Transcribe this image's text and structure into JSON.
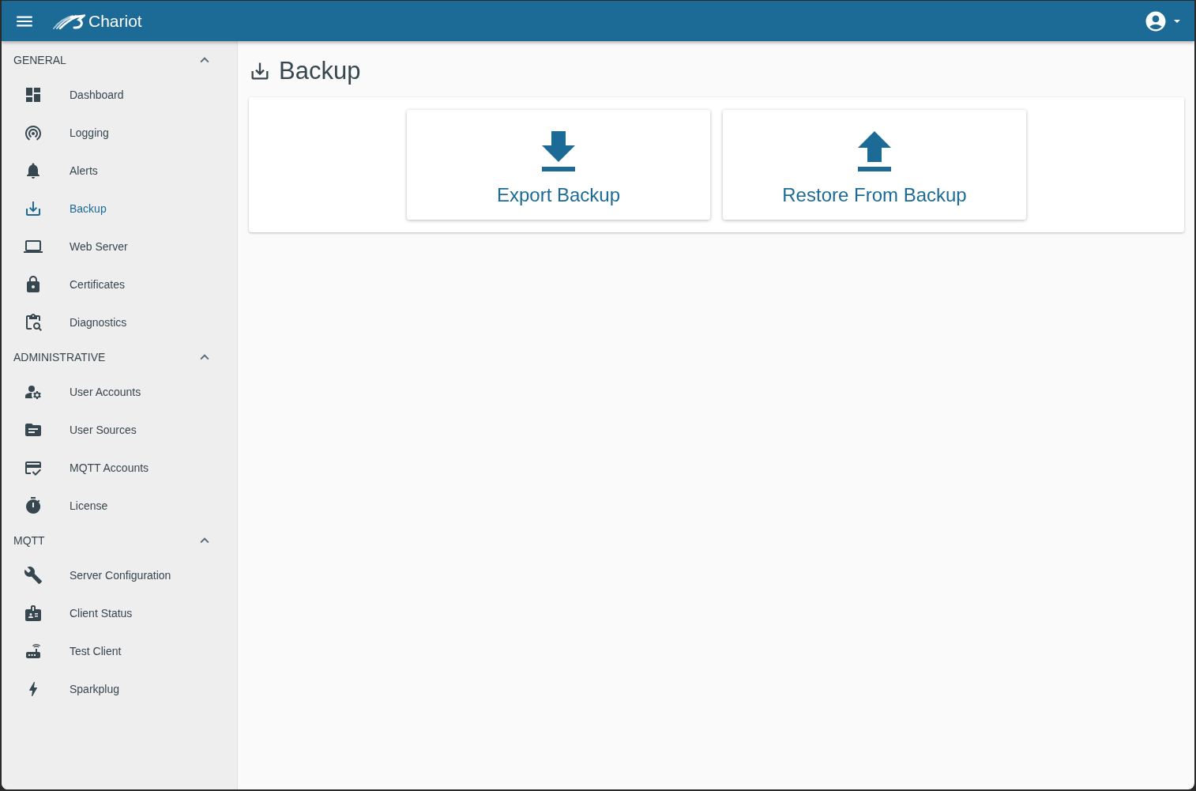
{
  "app_bar": {
    "title": "Chariot"
  },
  "sidebar": {
    "sections": [
      {
        "title": "GENERAL",
        "expanded": true,
        "items": [
          {
            "label": "Dashboard",
            "selected": false
          },
          {
            "label": "Logging",
            "selected": false
          },
          {
            "label": "Alerts",
            "selected": false
          },
          {
            "label": "Backup",
            "selected": true
          },
          {
            "label": "Web Server",
            "selected": false
          },
          {
            "label": "Certificates",
            "selected": false
          },
          {
            "label": "Diagnostics",
            "selected": false
          }
        ]
      },
      {
        "title": "ADMINISTRATIVE",
        "expanded": true,
        "items": [
          {
            "label": "User Accounts",
            "selected": false
          },
          {
            "label": "User Sources",
            "selected": false
          },
          {
            "label": "MQTT Accounts",
            "selected": false
          },
          {
            "label": "License",
            "selected": false
          }
        ]
      },
      {
        "title": "MQTT",
        "expanded": true,
        "items": [
          {
            "label": "Server Configuration",
            "selected": false
          },
          {
            "label": "Client Status",
            "selected": false
          },
          {
            "label": "Test Client",
            "selected": false
          },
          {
            "label": "Sparkplug",
            "selected": false
          }
        ]
      }
    ]
  },
  "page": {
    "title": "Backup",
    "actions": [
      {
        "kind": "export",
        "label": "Export Backup"
      },
      {
        "kind": "restore",
        "label": "Restore From Backup"
      }
    ]
  }
}
